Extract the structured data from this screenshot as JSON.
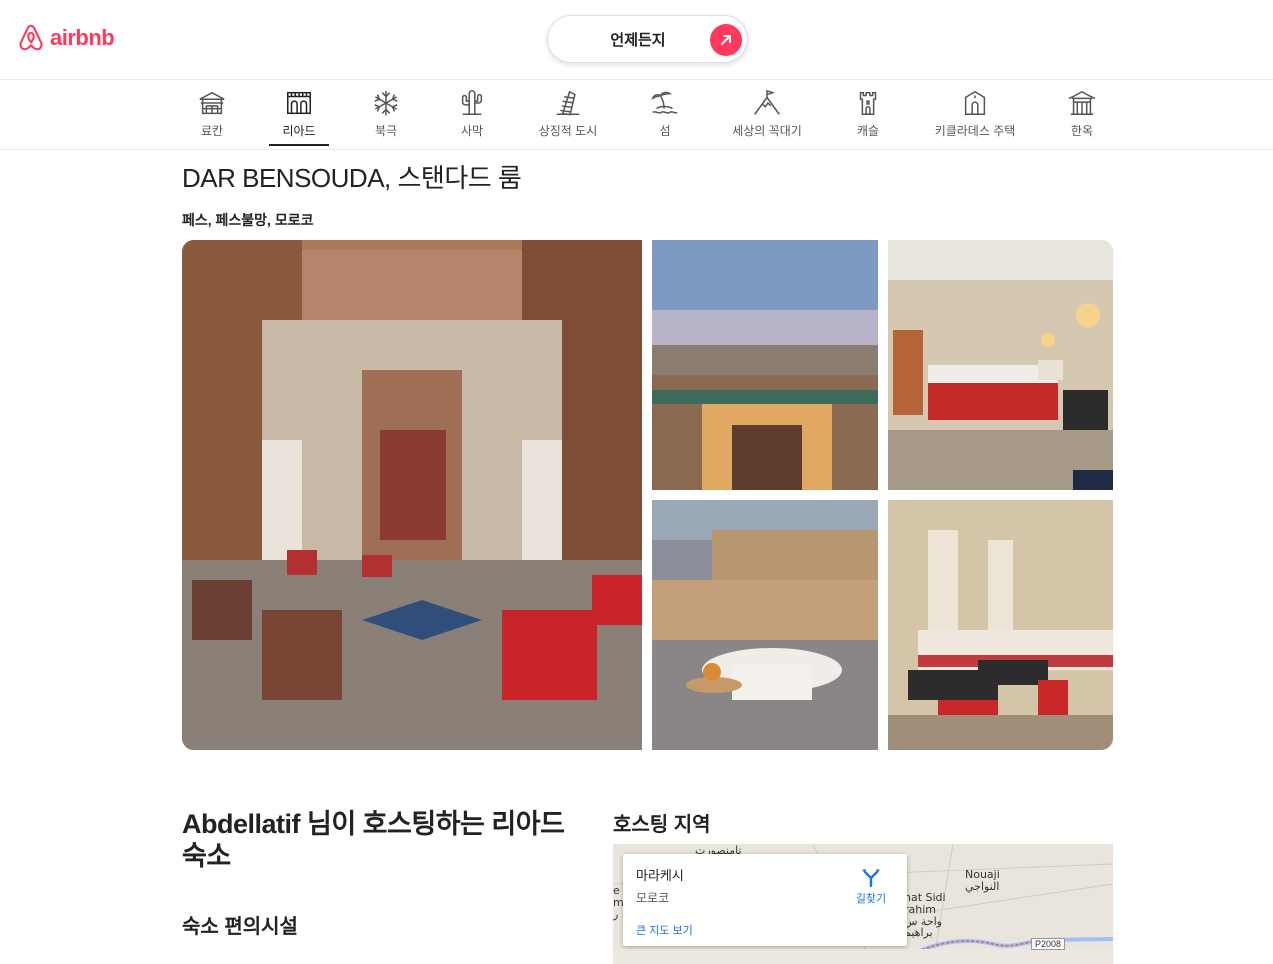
{
  "header": {
    "logo_text": "airbnb",
    "search_label": "언제든지",
    "brand_color": "#ff385c"
  },
  "categories": [
    {
      "label": "료칸",
      "icon": "ryokan-icon"
    },
    {
      "label": "리아드",
      "icon": "riad-icon",
      "active": true
    },
    {
      "label": "북극",
      "icon": "snowflake-icon"
    },
    {
      "label": "사막",
      "icon": "cactus-icon"
    },
    {
      "label": "상징적 도시",
      "icon": "leaning-tower-icon"
    },
    {
      "label": "섬",
      "icon": "island-icon"
    },
    {
      "label": "세상의 꼭대기",
      "icon": "mountain-flag-icon"
    },
    {
      "label": "캐슬",
      "icon": "castle-icon"
    },
    {
      "label": "키클라데스 주택",
      "icon": "cycladic-house-icon"
    },
    {
      "label": "한옥",
      "icon": "hanok-icon"
    }
  ],
  "listing": {
    "title": "DAR BENSOUDA, 스탠다드 룸",
    "location": "페스, 페스불망, 모로코"
  },
  "host": {
    "heading": "Abdellatif 님이 호스팅하는 리아드 숙소",
    "amenities_heading": "숙소 편의시설"
  },
  "area": {
    "heading": "호스팅 지역",
    "map": {
      "city": "마라케시",
      "country": "모로코",
      "directions_label": "길찾기",
      "larger_map_label": "큰 지도 보기",
      "labels": {
        "nouaji": "Nouaji",
        "nouaji_ar": "النواجي",
        "sidi": "hat Sidi",
        "rahim": "rahim",
        "waha": "واحة س",
        "barahim": "براهيم",
        "top_ar": "تامنصورت",
        "road": "P2008",
        "left_m": "e",
        "left_m2": "m",
        "left_r": "ر"
      }
    }
  }
}
